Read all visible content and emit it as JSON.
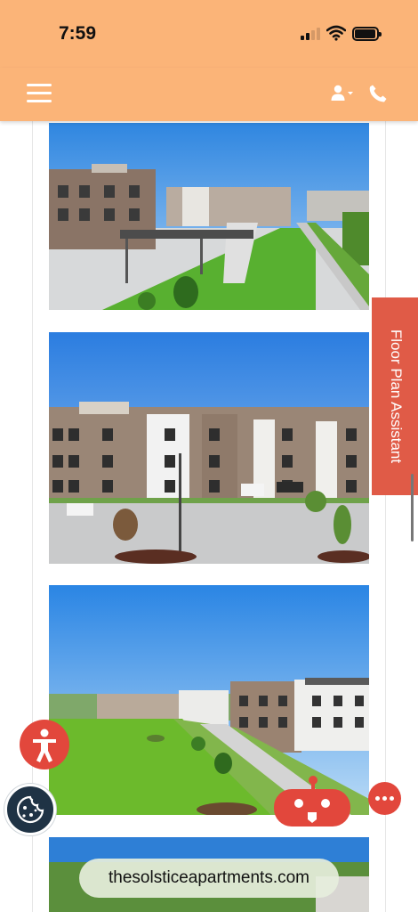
{
  "status_bar": {
    "time": "7:59"
  },
  "header": {
    "menu_icon": "hamburger-menu-icon",
    "user_icon": "user-dropdown-icon",
    "phone_icon": "phone-icon",
    "background_color": "#fbb478"
  },
  "gallery": {
    "images": [
      {
        "name": "apartment-photo-1"
      },
      {
        "name": "apartment-photo-2"
      },
      {
        "name": "apartment-photo-3"
      },
      {
        "name": "apartment-photo-4"
      }
    ]
  },
  "floor_plan_assistant": {
    "label": "Floor Plan Assistant",
    "color": "#e05b47"
  },
  "floating_buttons": {
    "accessibility": "accessibility-icon",
    "cookie": "cookie-icon",
    "chatbot": "chatbot-robot-icon",
    "more": "more-options-icon",
    "accent_color": "#e2473c"
  },
  "browser": {
    "url": "thesolsticeapartments.com"
  }
}
